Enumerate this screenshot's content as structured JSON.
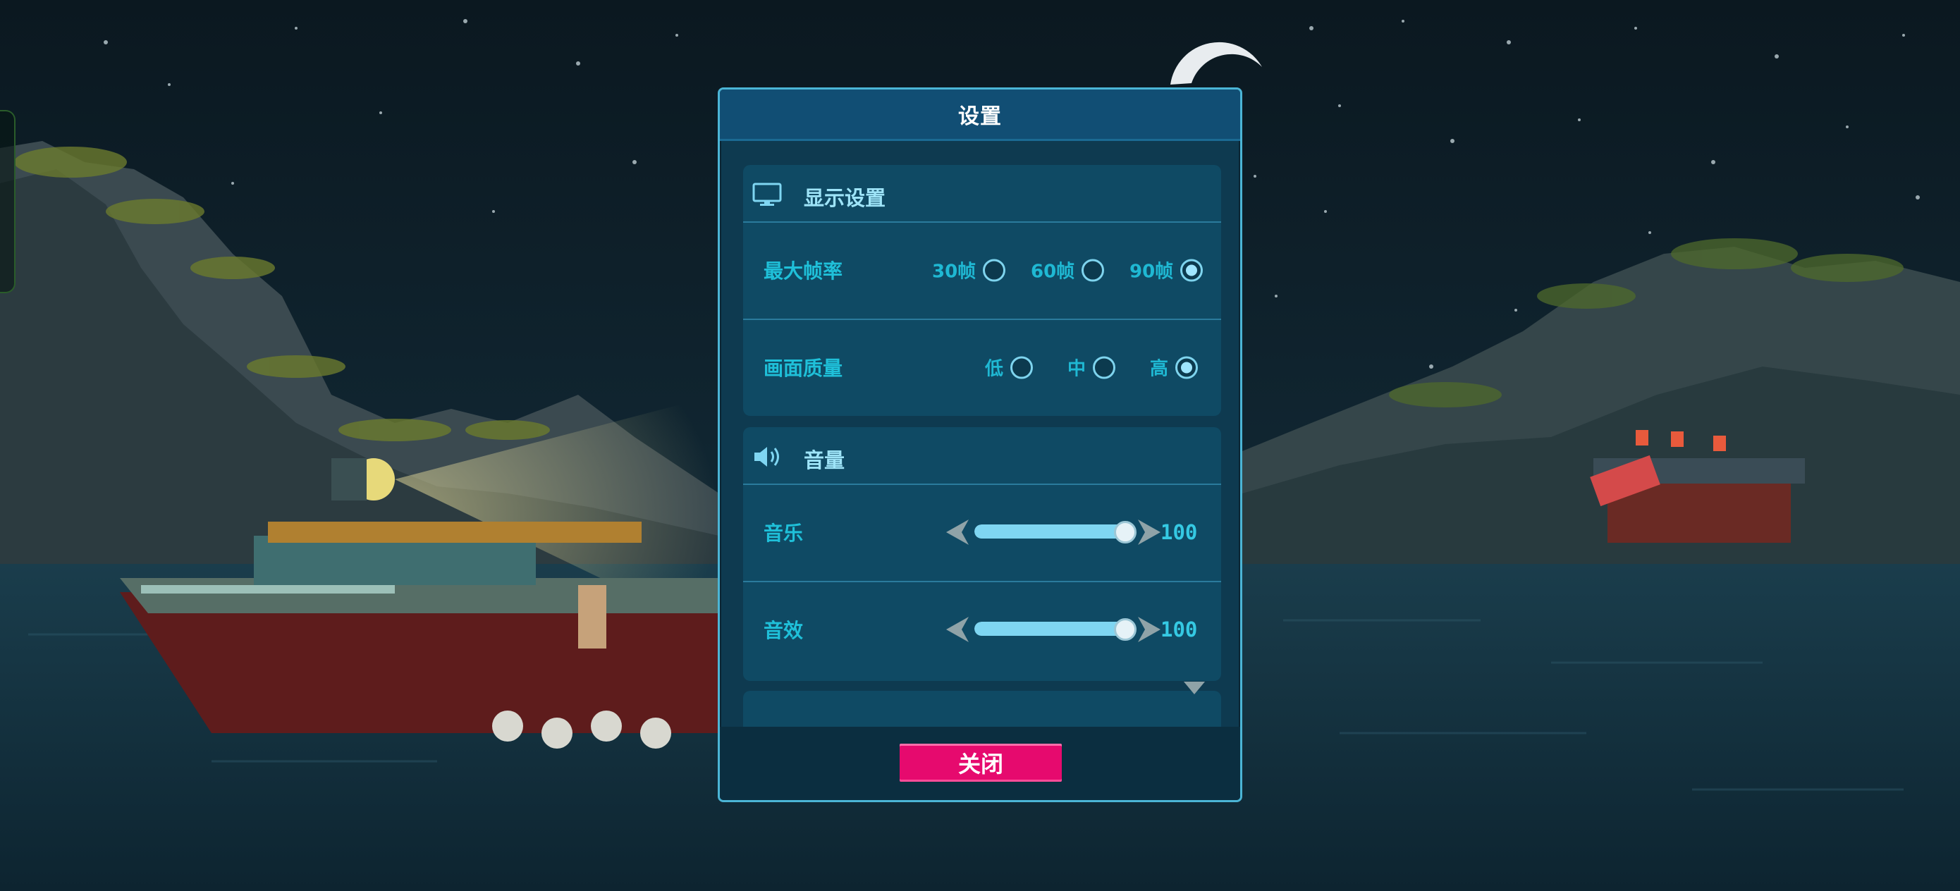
{
  "dialog": {
    "title": "设置",
    "close_label": "关闭"
  },
  "display": {
    "title": "显示设置",
    "icon": "monitor-icon",
    "framerate": {
      "label": "最大帧率",
      "options": [
        "30帧",
        "60帧",
        "90帧"
      ],
      "selected": "90帧"
    },
    "quality": {
      "label": "画面质量",
      "options": [
        "低",
        "中",
        "高"
      ],
      "selected": "高"
    }
  },
  "volume": {
    "title": "音量",
    "icon": "speaker-icon",
    "music": {
      "label": "音乐",
      "value": "100"
    },
    "sfx": {
      "label": "音效",
      "value": "100"
    }
  },
  "colors": {
    "accent": "#4bb5d6",
    "close_button": "#e60a6e",
    "label": "#1fc0d9"
  }
}
